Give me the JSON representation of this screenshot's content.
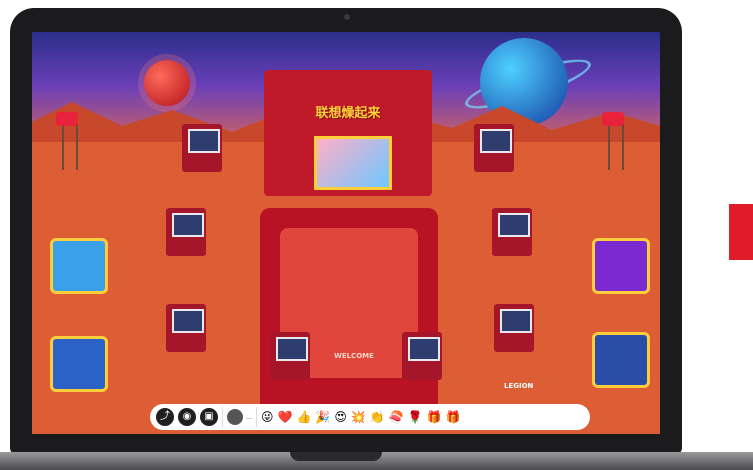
{
  "venue": {
    "stage_title": "联想燥起来",
    "floor_text": "WELCOME",
    "booth_brand": "LEGION"
  },
  "toolbar": {
    "buttons": [
      {
        "name": "share",
        "glyph": "⤴"
      },
      {
        "name": "avatar-menu",
        "glyph": "◉"
      },
      {
        "name": "camera",
        "glyph": "▣"
      }
    ],
    "user_name": "…",
    "reactions": [
      "😜",
      "❤️",
      "👍",
      "🎉",
      "😍",
      "💥",
      "👏",
      "🍣",
      "🌹",
      "🎁",
      "🎁"
    ]
  },
  "colors": {
    "laptop_bezel": "#1b1b1d",
    "mars_ground": "#dd5e35",
    "booth_red": "#a5162b",
    "accent_red": "#e01b2a"
  }
}
